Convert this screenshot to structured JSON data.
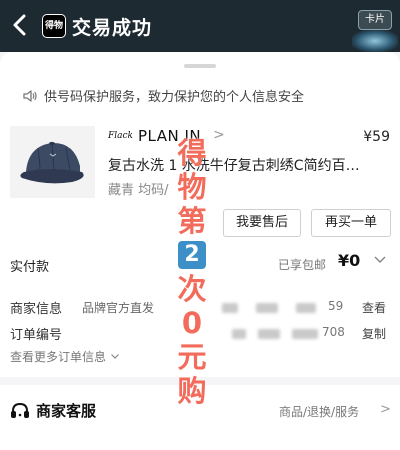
{
  "header": {
    "app_badge": "得物",
    "title": "交易成功",
    "card_button": "卡片"
  },
  "notice": "供号码保护服务，致力保护您的个人信息安全",
  "product": {
    "brand_logo": "Flack",
    "brand": "PLAN IN",
    "price": "¥59",
    "title": "复古水洗 1 水洗牛仔复古刺绣C简约百…",
    "spec": "藏青 均码/",
    "buttons": {
      "after_sale": "我要售后",
      "rebuy": "再买一单"
    }
  },
  "payment": {
    "label": "实付款",
    "shipping": "已享包邮",
    "amount": "¥0"
  },
  "merchant": {
    "label": "商家信息",
    "type": "品牌官方直发",
    "tail": "59",
    "action": "查看"
  },
  "order": {
    "label": "订单编号",
    "tail": "708",
    "action": "复制"
  },
  "more_orders": "查看更多订单信息",
  "customer_service": {
    "title": "商家客服",
    "links": "商品/退换/服务"
  },
  "promo": {
    "chars": [
      "得",
      "物",
      "第",
      "2",
      "次",
      "0",
      "元",
      "购"
    ]
  },
  "colors": {
    "header_bg": "#1e2a31",
    "promo_text": "#f26b5b",
    "promo_number_bg": "#3d8fc7"
  },
  "icons": {
    "back": "back-arrow-icon",
    "notice": "speaker-icon",
    "customer_service": "headset-icon"
  }
}
